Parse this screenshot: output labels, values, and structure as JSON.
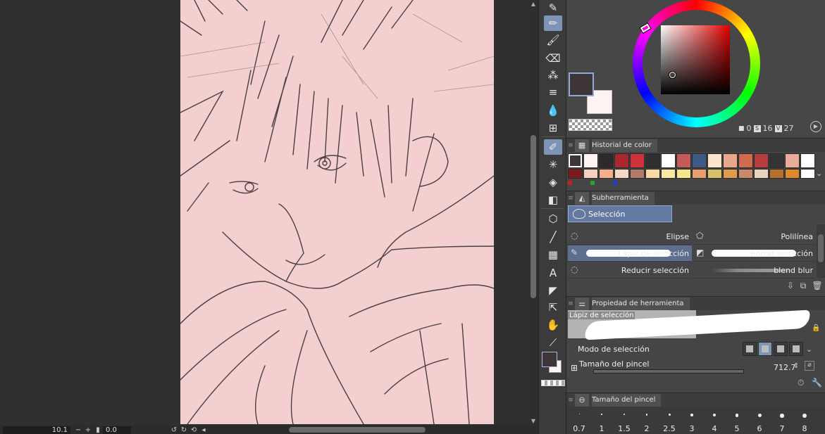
{
  "status": {
    "zoom": "10.1",
    "angle": "0.0"
  },
  "color": {
    "main": "#3e3537",
    "sub": "#fdf3f3",
    "hsv": {
      "h": "0",
      "s": "16",
      "v": "27"
    }
  },
  "panels": {
    "color_history": "Historial de color",
    "subtool": "Subherramienta",
    "tool_property": "Propiedad de herramienta",
    "brush_size": "Tamaño del pincel"
  },
  "history": {
    "row1": [
      "#3e3537",
      "#fdf3f3",
      "#2e2a2b",
      "#a9272d",
      "#cf323a",
      "#2f2f2f",
      "#ffffff",
      "#c55a5a",
      "#3d5a86",
      "#fce4cf",
      "#e7a88d",
      "#d06b4f",
      "#b83d3d",
      "#343434",
      "#e8ad99",
      "#ffffff"
    ],
    "row2": [
      "#7a1a1f",
      "#f6cfbf",
      "#f5b08a",
      "#f4d7c6",
      "#b57a68",
      "#fad8a6",
      "#fae9a0",
      "#f8e58a",
      "#e8a06a",
      "#d9c06a",
      "#e19a4e",
      "#c88a6b",
      "#e8d3bf",
      "#b5702a",
      "#e08a2c",
      "#ffffff"
    ],
    "mini": [
      "#c81e1e",
      "#2aa02a",
      "#1e3cc8"
    ]
  },
  "subtool": {
    "group": "Selección",
    "items": [
      {
        "label": "Elipse",
        "col": "left"
      },
      {
        "label": "Polilínea",
        "col": "right"
      },
      {
        "label": "Lápiz de selección",
        "col": "left",
        "selected": true
      },
      {
        "label": "Borrar selección",
        "col": "right"
      },
      {
        "label": "Reducir selección",
        "col": "left"
      },
      {
        "label": "blend blur",
        "col": "right"
      }
    ]
  },
  "tool_property": {
    "preview_name": "Lápiz de selección",
    "selection_mode_label": "Modo de selección",
    "brush_size_label": "Tamaño del pincel",
    "brush_size_value": "712.7"
  },
  "brush_sizes": [
    "0.7",
    "1",
    "1.5",
    "2",
    "2.5",
    "3",
    "4",
    "5",
    "6",
    "7",
    "8"
  ],
  "icons": {
    "toolbar": [
      "pen-icon",
      "pencil-icon",
      "brush-icon",
      "eraser-icon",
      "deco-icon",
      "lines-icon",
      "blend-icon",
      "ruler-icon",
      "selection-pen-icon",
      "auto-select-icon",
      "fill-icon",
      "gradient-icon",
      "object-icon",
      "line-icon",
      "frame-icon",
      "text-icon",
      "balloon-icon",
      "operation-icon",
      "hand-icon",
      "eyedropper-icon"
    ]
  }
}
